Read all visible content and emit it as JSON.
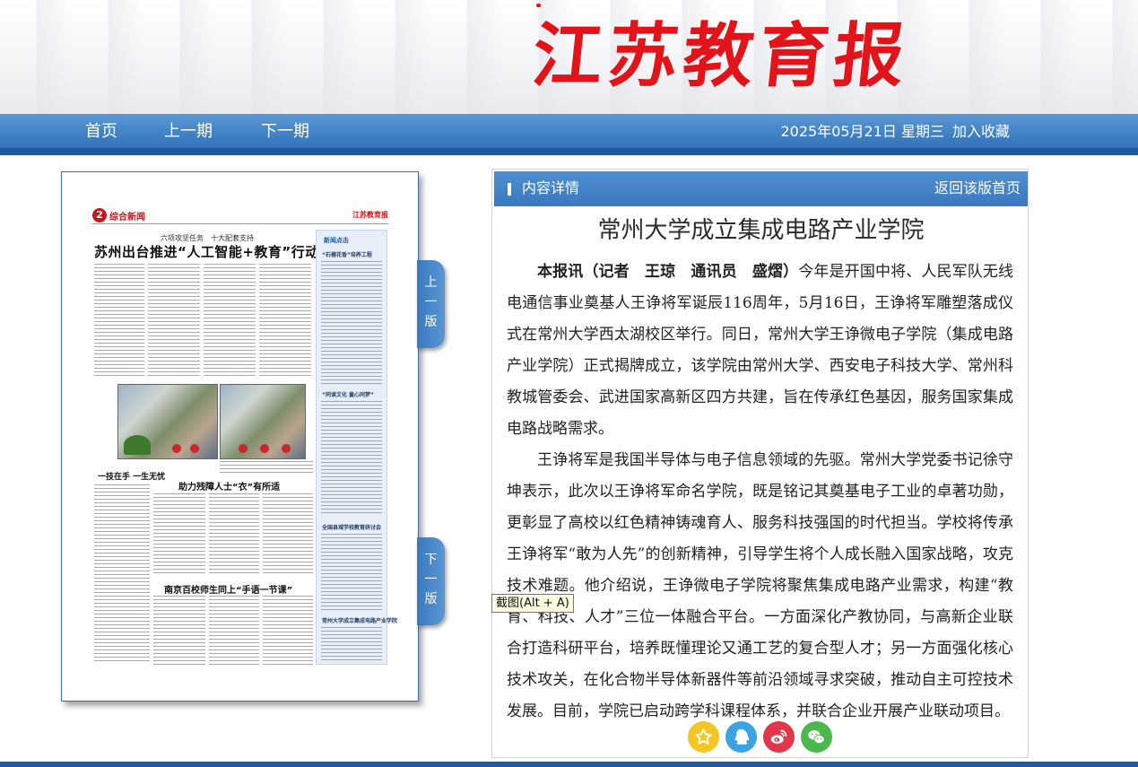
{
  "masthead": {
    "logo_text": "江苏教育报"
  },
  "nav": {
    "home": "首页",
    "prev_issue": "上一期",
    "next_issue": "下一期",
    "date": "2025年05月21日 星期三",
    "favorite": "加入收藏"
  },
  "page_preview": {
    "page_number": "2",
    "section": "综合新闻",
    "mini_logo": "江苏教育报",
    "kicker": "六项攻坚任务　十大配套支持",
    "headline": "苏州出台推进“人工智能+教育”行动方案",
    "sidebar_title": "新闻点击",
    "sidebar_heading_1": "“石榴花香”培养工程",
    "sidebar_heading_2": "“同读文化 童心同梦”",
    "sidebar_heading_3": "全国县域学校教育研讨会",
    "sidebar_heading_4": "常州大学成立集成电路产业学院",
    "sub_headline_1": "一技在手 一生无忧",
    "sub_headline_2": "助力残障人士“衣”有所适",
    "sub_headline_3": "南京百校师生同上“手语一节课”"
  },
  "side_tabs": {
    "prev_page": "上一版",
    "next_page": "下一版"
  },
  "panel": {
    "title": "内容详情",
    "back": "返回该版首页"
  },
  "article": {
    "title": "常州大学成立集成电路产业学院",
    "byline": "本报讯（记者　王琼　通讯员　盛熠）",
    "para1_rest": "今年是开国中将、人民军队无线电通信事业奠基人王诤将军诞辰116周年，5月16日，王诤将军雕塑落成仪式在常州大学西太湖校区举行。同日，常州大学王诤微电子学院（集成电路产业学院）正式揭牌成立，该学院由常州大学、西安电子科技大学、常州科教城管委会、武进国家高新区四方共建，旨在传承红色基因，服务国家集成电路战略需求。",
    "para2": "王诤将军是我国半导体与电子信息领域的先驱。常州大学党委书记徐守坤表示，此次以王诤将军命名学院，既是铭记其奠基电子工业的卓著功勋，更彰显了高校以红色精神铸魂育人、服务科技强国的时代担当。学校将传承王诤将军“敢为人先”的创新精神，引导学生将个人成长融入国家战略，攻克技术难题。他介绍说，王诤微电子学院将聚焦集成电路产业需求，构建“教育、科技、人才”三位一体融合平台。一方面深化产教协同，与高新企业联合打造科研平台，培养既懂理论又通工艺的复合型人才；另一方面强化核心技术攻关，在化合物半导体新器件等前沿领域寻求突破，推动自主可控技术发展。目前，学院已启动跨学科课程体系，并联合企业开展产业联动项目。"
  },
  "share_icons": [
    {
      "name": "favorite-star-icon",
      "color": "#f3c623"
    },
    {
      "name": "qq-icon",
      "color": "#3aa3e3"
    },
    {
      "name": "weibo-icon",
      "color": "#e2374a"
    },
    {
      "name": "wechat-icon",
      "color": "#4cb84c"
    }
  ],
  "tooltip": {
    "text": "截图(Alt + A)"
  }
}
